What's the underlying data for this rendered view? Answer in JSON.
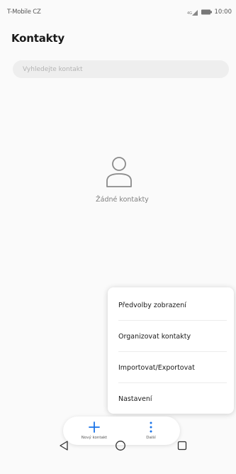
{
  "status_bar": {
    "carrier": "T-Mobile CZ",
    "time": "10:00"
  },
  "header": {
    "title": "Kontakty"
  },
  "search": {
    "placeholder": "Vyhledejte kontakt"
  },
  "empty_state": {
    "icon": "person-icon",
    "text": "Žádné kontakty"
  },
  "popup_menu": {
    "items": [
      {
        "label": "Předvolby zobrazení"
      },
      {
        "label": "Organizovat kontakty"
      },
      {
        "label": "Importovat/Exportovat"
      },
      {
        "label": "Nastavení"
      }
    ]
  },
  "action_bar": {
    "new_contact_label": "Nový kontakt",
    "more_label": "Další"
  },
  "colors": {
    "accent": "#1a73e8",
    "background": "#fafafa"
  },
  "nav_bar": {
    "icons": [
      "back-triangle-icon",
      "home-circle-icon",
      "recent-square-icon"
    ]
  }
}
